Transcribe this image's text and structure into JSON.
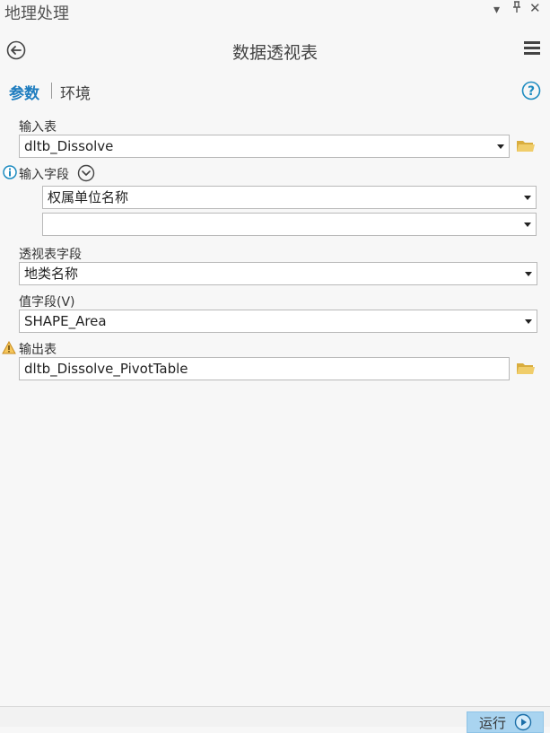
{
  "pane": {
    "title": "地理处理",
    "controls": {
      "pin_menu": "▾",
      "pin": "⊓",
      "close": "✕"
    }
  },
  "tool": {
    "title": "数据透视表"
  },
  "tabs": [
    {
      "label": "参数",
      "active": true
    },
    {
      "label": "环境",
      "active": false
    }
  ],
  "params": {
    "input_table": {
      "label": "输入表",
      "value": "dltb_Dissolve"
    },
    "input_fields": {
      "label": "输入字段",
      "values": [
        "权属单位名称",
        ""
      ]
    },
    "pivot_field": {
      "label": "透视表字段",
      "value": "地类名称"
    },
    "value_field": {
      "label": "值字段(V)",
      "value": "SHAPE_Area"
    },
    "output_table": {
      "label": "输出表",
      "value": "dltb_Dissolve_PivotTable"
    }
  },
  "footer": {
    "run_label": "运行"
  },
  "colors": {
    "accent": "#1f7dbf",
    "info": "#1c8bc0",
    "warning": "#e6a23c",
    "folder": "#e8c25a",
    "run_bg": "#a9d4f0"
  }
}
